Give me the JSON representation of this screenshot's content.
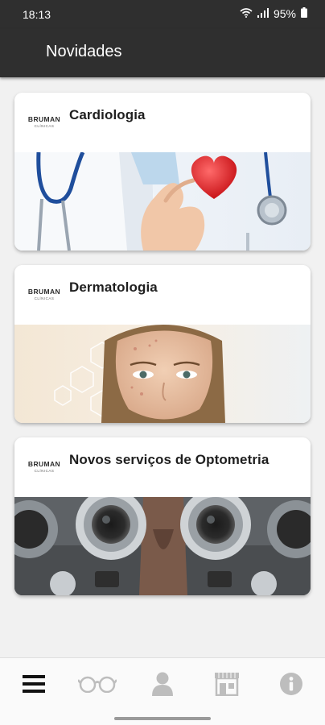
{
  "status_bar": {
    "time": "18:13",
    "battery": "95%",
    "icons": [
      "wifi-icon",
      "signal-icon",
      "battery-icon"
    ]
  },
  "app_bar": {
    "title": "Novidades"
  },
  "logo": {
    "line1": "BRUMAN",
    "line2": "CLÍNICAS"
  },
  "news": [
    {
      "title": "Cardiologia",
      "image": "cardiology-heart-stethoscope"
    },
    {
      "title": "Dermatologia",
      "image": "dermatology-face"
    },
    {
      "title": "Novos serviços de Optometria",
      "image": "optometry-phoropter"
    }
  ],
  "bottom_nav": {
    "items": [
      "menu-icon",
      "glasses-icon",
      "person-icon",
      "store-icon",
      "info-icon"
    ],
    "active_index": 0
  },
  "colors": {
    "app_bar": "#2f2f2f",
    "background": "#f1f1f1",
    "card": "#ffffff",
    "nav_active": "#111111",
    "nav_inactive": "#bdbdbd"
  }
}
